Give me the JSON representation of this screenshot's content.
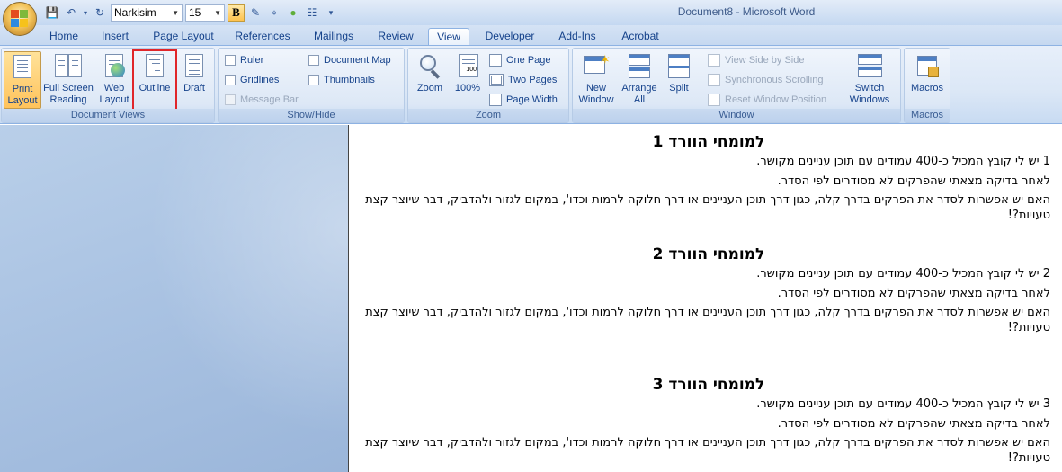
{
  "window": {
    "title": "Document8 - Microsoft Word"
  },
  "quick_access": {
    "font_name": "Narkisim",
    "font_size": "15",
    "bold_label": "B"
  },
  "tabs": [
    {
      "label": "Home"
    },
    {
      "label": "Insert"
    },
    {
      "label": "Page Layout"
    },
    {
      "label": "References"
    },
    {
      "label": "Mailings"
    },
    {
      "label": "Review"
    },
    {
      "label": "View"
    },
    {
      "label": "Developer"
    },
    {
      "label": "Add-Ins"
    },
    {
      "label": "Acrobat"
    }
  ],
  "active_tab": "View",
  "ribbon": {
    "document_views": {
      "label": "Document Views",
      "print_layout": "Print Layout",
      "full_screen_reading": "Full Screen Reading",
      "web_layout": "Web Layout",
      "outline": "Outline",
      "draft": "Draft"
    },
    "show_hide": {
      "label": "Show/Hide",
      "ruler": "Ruler",
      "gridlines": "Gridlines",
      "message_bar": "Message Bar",
      "document_map": "Document Map",
      "thumbnails": "Thumbnails"
    },
    "zoom": {
      "label": "Zoom",
      "zoom": "Zoom",
      "hundred": "100%",
      "one_page": "One Page",
      "two_pages": "Two Pages",
      "page_width": "Page Width"
    },
    "window": {
      "label": "Window",
      "new_window": "New Window",
      "arrange_all": "Arrange All",
      "split": "Split",
      "view_side_by_side": "View Side by Side",
      "synchronous_scrolling": "Synchronous Scrolling",
      "reset_window_position": "Reset Window Position",
      "switch_windows": "Switch Windows"
    },
    "macros": {
      "label": "Macros",
      "macros": "Macros"
    }
  },
  "document": {
    "sections": [
      {
        "heading": "למומחי הוורד 1",
        "line1": "1 יש לי קובץ המכיל כ-400 עמודים עם תוכן עניינים מקושר.",
        "line2": "לאחר בדיקה מצאתי שהפרקים לא מסודרים לפי הסדר.",
        "line3": "האם יש אפשרות לסדר את הפרקים בדרך קלה, כגון דרך תוכן העניינים או דרך חלוקה לרמות וכדו', במקום לגזור ולהדביק, דבר שיוצר קצת טעויות?!"
      },
      {
        "heading": "למומחי הוורד 2",
        "line1": "2 יש לי קובץ המכיל כ-400 עמודים עם תוכן עניינים מקושר.",
        "line2": "לאחר בדיקה מצאתי שהפרקים לא מסודרים לפי הסדר.",
        "line3": "האם יש אפשרות לסדר את הפרקים בדרך קלה, כגון דרך תוכן העניינים או דרך חלוקה לרמות וכדו', במקום לגזור ולהדביק, דבר שיוצר קצת טעויות?!"
      },
      {
        "heading": "למומחי הוורד 3",
        "line1": "3 יש לי קובץ המכיל כ-400 עמודים עם תוכן עניינים מקושר.",
        "line2": "לאחר בדיקה מצאתי שהפרקים לא מסודרים לפי הסדר.",
        "line3": "האם יש אפשרות לסדר את הפרקים בדרך קלה, כגון דרך תוכן העניינים או דרך חלוקה לרמות וכדו', במקום לגזור ולהדביק, דבר שיוצר קצת טעויות?!"
      }
    ]
  }
}
